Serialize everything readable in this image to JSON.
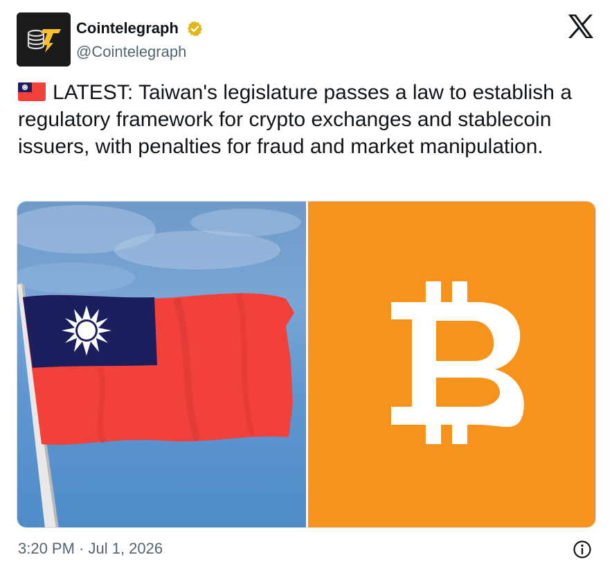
{
  "author": {
    "name": "Cointelegraph",
    "handle": "@Cointelegraph",
    "verified": true,
    "avatar_icon": "cointelegraph-logo"
  },
  "platform_icon": "x-logo",
  "tweet": {
    "flag_emoji": "taiwan-flag",
    "text": "LATEST: Taiwan's legislature passes a law to establish a regulatory framework for crypto exchanges and stablecoin issuers, with penalties for fraud and market manipulation."
  },
  "media": {
    "left_image": "taiwan-flag-photo",
    "right_image": "bitcoin-logo"
  },
  "footer": {
    "timestamp": "3:20 PM · Jul 1, 2026",
    "info_icon": "info-icon"
  },
  "colors": {
    "bitcoin_orange": "#f7931a",
    "text_primary": "#0f1419",
    "text_secondary": "#536471",
    "verified_gold": "#e2b719",
    "flag_red": "#f2413b",
    "flag_blue": "#1c1f5e"
  }
}
